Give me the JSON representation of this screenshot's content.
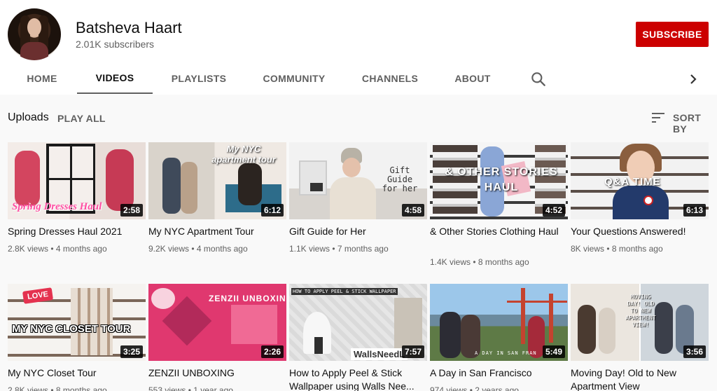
{
  "channel": {
    "name": "Batsheva Haart",
    "subscribers": "2.01K subscribers",
    "subscribe_label": "SUBSCRIBE"
  },
  "tabs": [
    {
      "label": "HOME"
    },
    {
      "label": "VIDEOS",
      "active": true
    },
    {
      "label": "PLAYLISTS"
    },
    {
      "label": "COMMUNITY"
    },
    {
      "label": "CHANNELS"
    },
    {
      "label": "ABOUT"
    }
  ],
  "icons": {
    "search": "search-icon",
    "next": "chevron-right-icon",
    "sort": "sort-icon"
  },
  "uploads": {
    "title": "Uploads",
    "play_all": "PLAY ALL",
    "sort_by": "SORT BY"
  },
  "colors": {
    "subscribe": "#cc0000",
    "page_bg": "#f9f9f9"
  },
  "videos": [
    {
      "title": "Spring Dresses Haul 2021",
      "views": "2.8K views",
      "age": "4 months ago",
      "duration": "2:58",
      "thumb_text": "Spring Dresses Haul"
    },
    {
      "title": "My NYC Apartment Tour",
      "views": "9.2K views",
      "age": "4 months ago",
      "duration": "6:12",
      "thumb_text": "My NYC apartment tour"
    },
    {
      "title": "Gift Guide for Her",
      "views": "1.1K views",
      "age": "7 months ago",
      "duration": "4:58",
      "thumb_text": "Gift Guide for her"
    },
    {
      "title": "& Other Stories Clothing Haul",
      "views": "1.4K views",
      "age": "8 months ago",
      "duration": "4:52",
      "thumb_text": "& OTHER STORIES HAUL"
    },
    {
      "title": "Your Questions Answered!",
      "views": "8K views",
      "age": "8 months ago",
      "duration": "6:13",
      "thumb_text": "Q&A TIME"
    },
    {
      "title": "My NYC Closet Tour",
      "views": "2.8K views",
      "age": "8 months ago",
      "duration": "3:25",
      "thumb_text": "MY NYC CLOSET TOUR",
      "badge": "LOVE"
    },
    {
      "title": "ZENZII UNBOXING",
      "views": "553 views",
      "age": "1 year ago",
      "duration": "2:26",
      "thumb_text": "ZENZII UNBOXING"
    },
    {
      "title": "How to Apply Peel & Stick Wallpaper using Walls Nee...",
      "views": "",
      "age": "",
      "duration": "7:57",
      "thumb_text": "HOW TO APPLY PEEL & STICK WALLPAPER",
      "thumb_text2": "WallsNeedL"
    },
    {
      "title": "A Day in San Francisco",
      "views": "974 views",
      "age": "2 years ago",
      "duration": "5:49",
      "thumb_text": "A DAY IN SAN FRAN"
    },
    {
      "title": "Moving Day! Old to New Apartment View",
      "views": "",
      "age": "",
      "duration": "3:56",
      "thumb_text": "MOVING DAY! OLD TO NEW APARTMENT VIEW!"
    }
  ]
}
